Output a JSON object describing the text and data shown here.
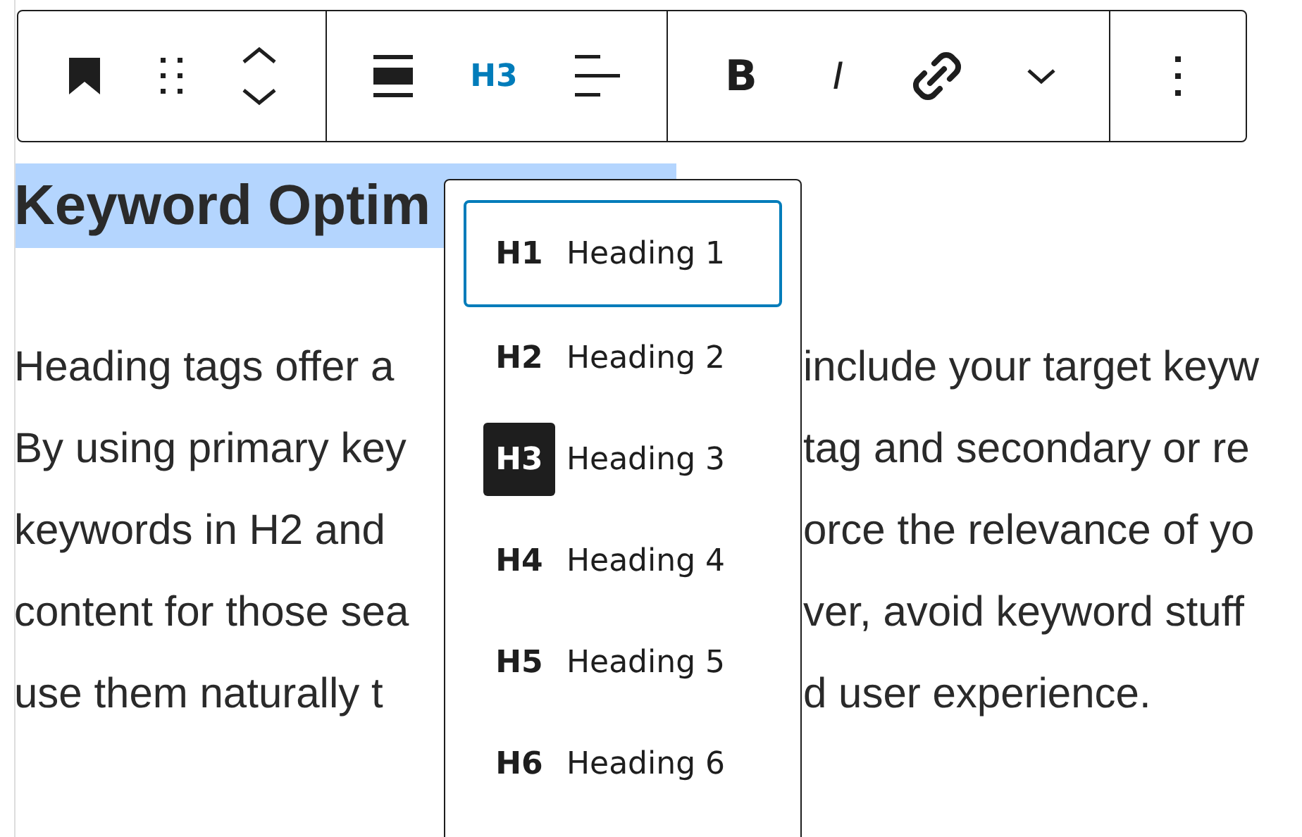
{
  "toolbar": {
    "heading_button": "H3",
    "bold_button": "B",
    "italic_button": "I"
  },
  "heading": {
    "text": "Keyword Optim",
    "highlighted": true
  },
  "paragraph_lines": [
    {
      "left": "Heading tags offer a",
      "right": "include your target keyw"
    },
    {
      "left": "By using primary key",
      "right": "tag and secondary or re"
    },
    {
      "left": "keywords in H2 and",
      "right": "orce the relevance of yo"
    },
    {
      "left": "content for those sea",
      "right": "ver, avoid keyword stuff"
    },
    {
      "left": "use them naturally t",
      "right": "d user experience."
    }
  ],
  "heading_menu": [
    {
      "tag": "H1",
      "label": "Heading 1",
      "focused": true,
      "selected": false
    },
    {
      "tag": "H2",
      "label": "Heading 2",
      "focused": false,
      "selected": false
    },
    {
      "tag": "H3",
      "label": "Heading 3",
      "focused": false,
      "selected": true
    },
    {
      "tag": "H4",
      "label": "Heading 4",
      "focused": false,
      "selected": false
    },
    {
      "tag": "H5",
      "label": "Heading 5",
      "focused": false,
      "selected": false
    },
    {
      "tag": "H6",
      "label": "Heading 6",
      "focused": false,
      "selected": false
    }
  ]
}
